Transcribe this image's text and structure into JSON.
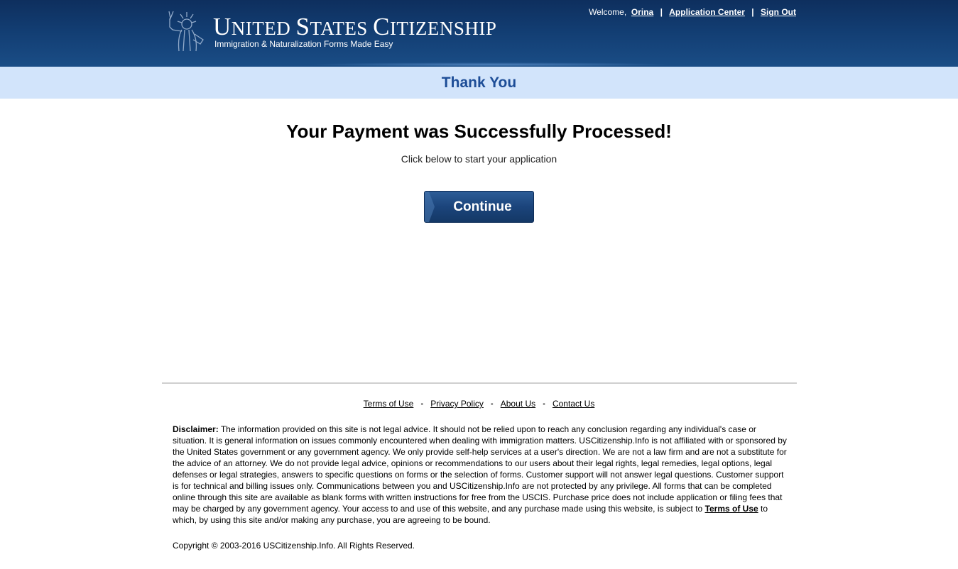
{
  "header": {
    "logo_title_parts": [
      {
        "cap": "U",
        "rest": "NITED "
      },
      {
        "cap": "S",
        "rest": "TATES "
      },
      {
        "cap": "C",
        "rest": "ITIZENSHIP"
      }
    ],
    "logo_subtitle": "Immigration & Naturalization Forms Made Easy",
    "welcome_text": "Welcome,",
    "user_name": "Orina",
    "application_center": "Application Center",
    "sign_out": "Sign Out",
    "separator": "|",
    "icon": "statue-of-liberty-icon"
  },
  "band": {
    "title": "Thank You"
  },
  "main": {
    "heading": "Your Payment was Successfully Processed!",
    "subtext": "Click below to start your application",
    "continue_label": "Continue"
  },
  "footer": {
    "links": [
      "Terms of Use",
      "Privacy Policy",
      "About Us",
      "Contact Us"
    ],
    "link_separator": "•",
    "disclaimer_label": "Disclaimer:",
    "disclaimer_text_1": " The information provided on this site is not legal advice. It should not be relied upon to reach any conclusion regarding any individual's case or situation. It is general information on issues commonly encountered when dealing with immigration matters. USCitizenship.Info is not affiliated with or sponsored by the United States government or any government agency. We only provide self-help services at a user's direction. We are not a law firm and are not a substitute for the advice of an attorney. We do not provide legal advice, opinions or recommendations to our users about their legal rights, legal remedies, legal options, legal defenses or legal strategies, answers to specific questions on forms or the selection of forms. Customer support will not answer legal questions. Customer support is for technical and billing issues only. Communications between you and USCitizenship.Info are not protected by any privilege. All forms that can be completed online through this site are available as blank forms with written instructions for free from the USCIS. Purchase price does not include application or filing fees that may be charged by any government agency. Your access to and use of this website, and any purchase made using this website, is subject to ",
    "disclaimer_link": "Terms of Use",
    "disclaimer_text_2": " to which, by using this site and/or making any purchase, you are agreeing to be bound.",
    "copyright": "Copyright © 2003-2016 USCitizenship.Info. All Rights Reserved."
  },
  "colors": {
    "header_bg": "#123d72",
    "band_bg": "#d2e4fb",
    "band_title": "#1d4d97",
    "button_bg": "#1b447b"
  }
}
